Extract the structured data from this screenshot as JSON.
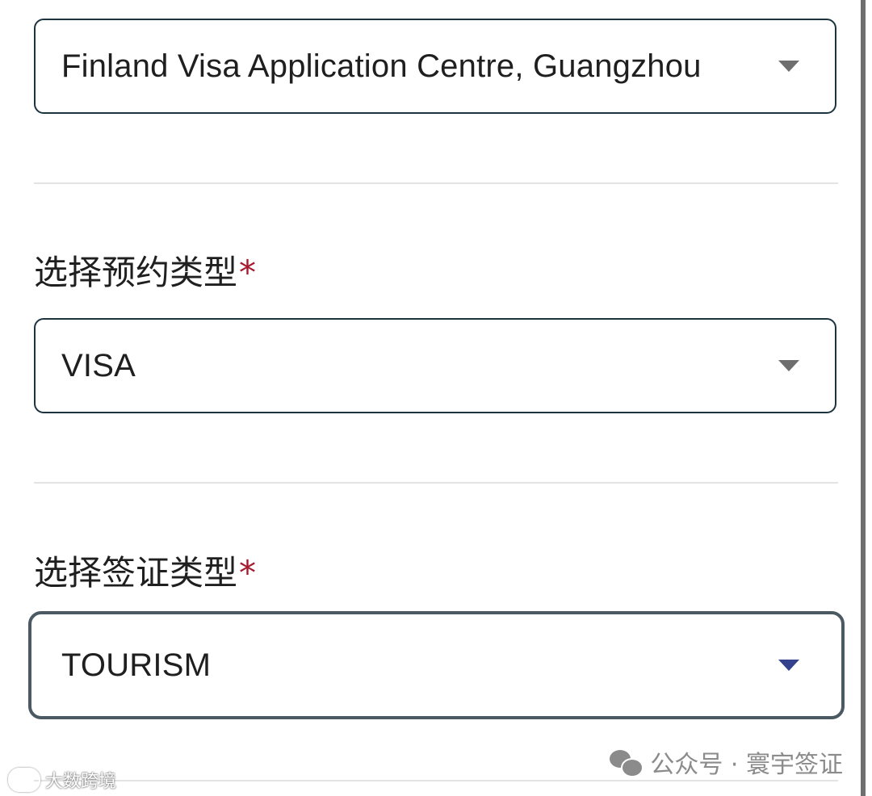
{
  "form": {
    "centre_select": {
      "value": "Finland Visa Application Centre, Guangzhou"
    },
    "appointment_type": {
      "label": "选择预约类型",
      "required_mark": "*",
      "value": "VISA"
    },
    "visa_type": {
      "label": "选择签证类型",
      "required_mark": "*",
      "value": "TOURISM"
    }
  },
  "watermark": {
    "text": "公众号 · 寰宇签证",
    "corner_text": "大数跨境"
  },
  "colors": {
    "field_border": "#1c3340",
    "required": "#a6192e",
    "focused_caret": "#34428e",
    "divider": "#e3e3e3"
  }
}
